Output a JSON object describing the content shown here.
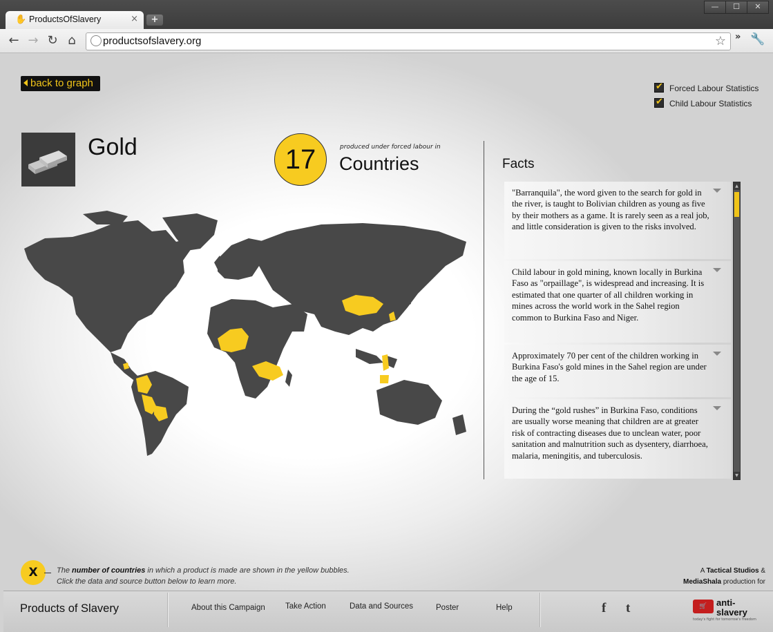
{
  "browser": {
    "tab_title": "ProductsOfSlavery",
    "url": "productsofslavery.org",
    "new_tab_label": "+",
    "window_buttons": [
      "—",
      "☐",
      "✕"
    ]
  },
  "page": {
    "back_label": "back to graph",
    "filters": [
      {
        "label": "Forced Labour Statistics",
        "checked": true
      },
      {
        "label": "Child Labour Statistics",
        "checked": true
      }
    ],
    "product": {
      "name": "Gold",
      "icon": "gold-bars-icon"
    },
    "bubble": {
      "count": "17",
      "subtitle": "produced under forced labour in",
      "unit": "Countries"
    },
    "facts_heading": "Facts",
    "facts": [
      "\"Barranquila\", the word given to the search for gold in the river, is taught to Bolivian children as young as five by their mothers as a game. It is rarely seen as a real job, and little consideration is given to the risks involved.",
      "Child labour in gold mining, known locally in Burkina Faso as \"orpaillage\", is widespread and increasing. It is estimated that one quarter of all children working in mines across the world work in the Sahel region common to Burkina Faso and Niger.",
      "Approximately 70 per cent of the children working in Burkina Faso's gold mines in the Sahel region are under the age of 15.",
      "During the “gold rushes” in Burkina Faso, conditions are usually worse meaning that children are at greater risk of contracting diseases due to unclean water, poor sanitation and malnutrition such as dysentery, diarrhoea, malaria, meningitis, and tuberculosis."
    ],
    "legend": {
      "bubble_label": "X",
      "prefix": "The ",
      "bold": "number of countries",
      "suffix": " in which a product is made are shown in the yellow bubbles.",
      "line2": "Click the data and source button below to learn more."
    },
    "credit": {
      "a": "A ",
      "studio1": "Tactical Studios",
      "amp": " &",
      "studio2": "MediaShala",
      "tail": " production for"
    },
    "colors": {
      "accent": "#f7cb20",
      "land": "#484848"
    }
  },
  "footer": {
    "brand": "Products of Slavery",
    "links": [
      "About this Campaign",
      "Take Action",
      "Data and Sources",
      "Poster",
      "Help"
    ],
    "social": [
      "facebook-icon",
      "twitter-icon"
    ],
    "logo_word": "anti-slavery",
    "logo_word_1": "anti-",
    "logo_word_2": "slavery",
    "logo_tagline": "today's fight for tomorrow's freedom"
  }
}
